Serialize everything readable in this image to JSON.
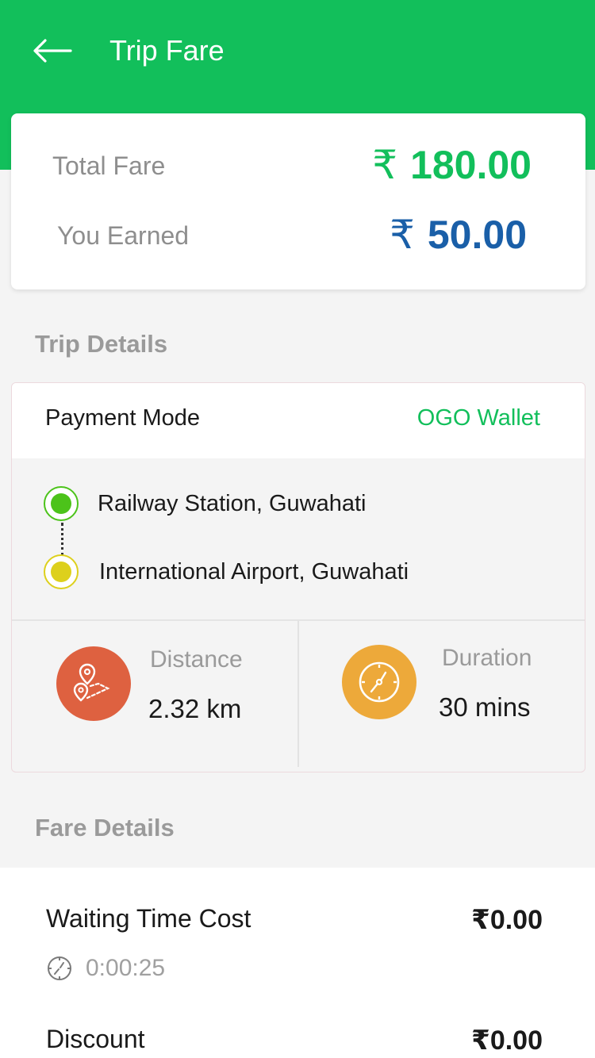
{
  "header": {
    "title": "Trip Fare",
    "back_icon": "arrow-left-icon",
    "color": "#12bf5b"
  },
  "fare_summary": {
    "total_label": "Total Fare",
    "total_currency": "₹",
    "total_amount": "180.00",
    "total_color": "#12bf5b",
    "earned_label": "You Earned",
    "earned_currency": "₹",
    "earned_amount": "50.00",
    "earned_color": "#1a5fa8"
  },
  "trip_details": {
    "section_title": "Trip Details",
    "payment_label": "Payment Mode",
    "payment_value": "OGO Wallet",
    "pickup": "Railway Station, Guwahati",
    "pickup_color": "#4cc31a",
    "drop": "International Airport, Guwahati",
    "drop_color": "#ddd01c",
    "distance_label": "Distance",
    "distance_value": "2.32 km",
    "distance_icon": "route-pins-icon",
    "distance_icon_color": "#de6140",
    "duration_label": "Duration",
    "duration_value": "30 mins",
    "duration_icon": "clock-icon",
    "duration_icon_color": "#eda93a"
  },
  "fare_details": {
    "section_title": "Fare Details",
    "items": [
      {
        "label": "Waiting Time Cost",
        "value": "₹0.00",
        "sub": "0:00:25",
        "sub_icon": "clock-icon"
      },
      {
        "label": "Discount",
        "value": "₹0.00"
      }
    ]
  }
}
